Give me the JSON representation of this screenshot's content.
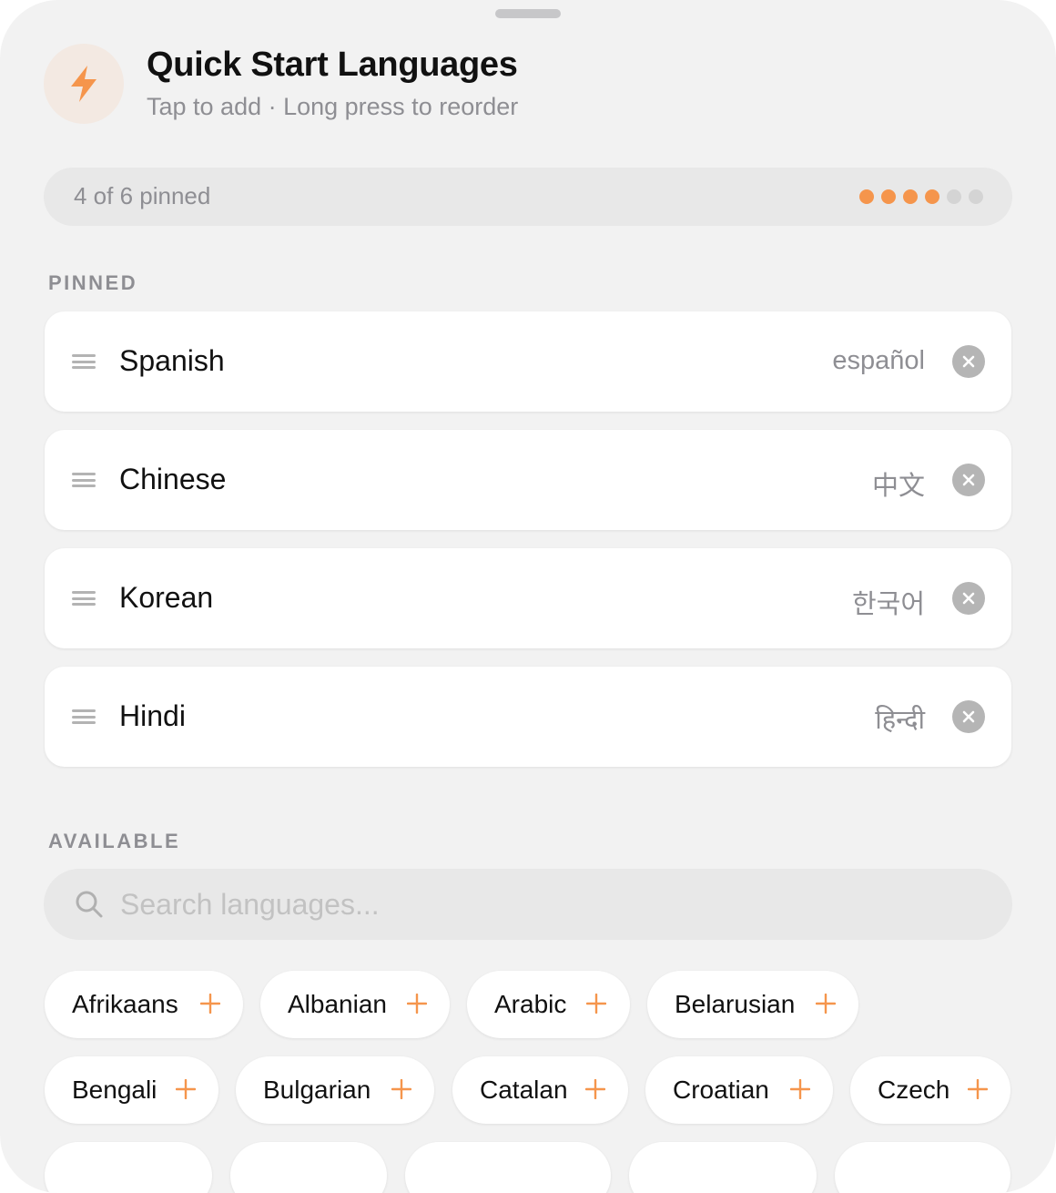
{
  "header": {
    "title": "Quick Start Languages",
    "subtitle": "Tap to add · Long press to reorder",
    "icon": "lightning-bolt-icon"
  },
  "pin_status": {
    "text": "4 of 6 pinned",
    "pinned": 4,
    "max": 6
  },
  "sections": {
    "pinned": "PINNED",
    "available": "AVAILABLE"
  },
  "pinned_languages": [
    {
      "name": "Spanish",
      "native": "español"
    },
    {
      "name": "Chinese",
      "native": "中文"
    },
    {
      "name": "Korean",
      "native": "한국어"
    },
    {
      "name": "Hindi",
      "native": "हिन्दी"
    }
  ],
  "search": {
    "placeholder": "Search languages...",
    "value": ""
  },
  "available_languages": [
    "Afrikaans",
    "Albanian",
    "Arabic",
    "Belarusian",
    "Bengali",
    "Bulgarian",
    "Catalan",
    "Croatian",
    "Czech"
  ],
  "colors": {
    "accent": "#f5954c",
    "background": "#f2f2f2",
    "card": "#ffffff",
    "secondary_text": "#8e8e93"
  }
}
